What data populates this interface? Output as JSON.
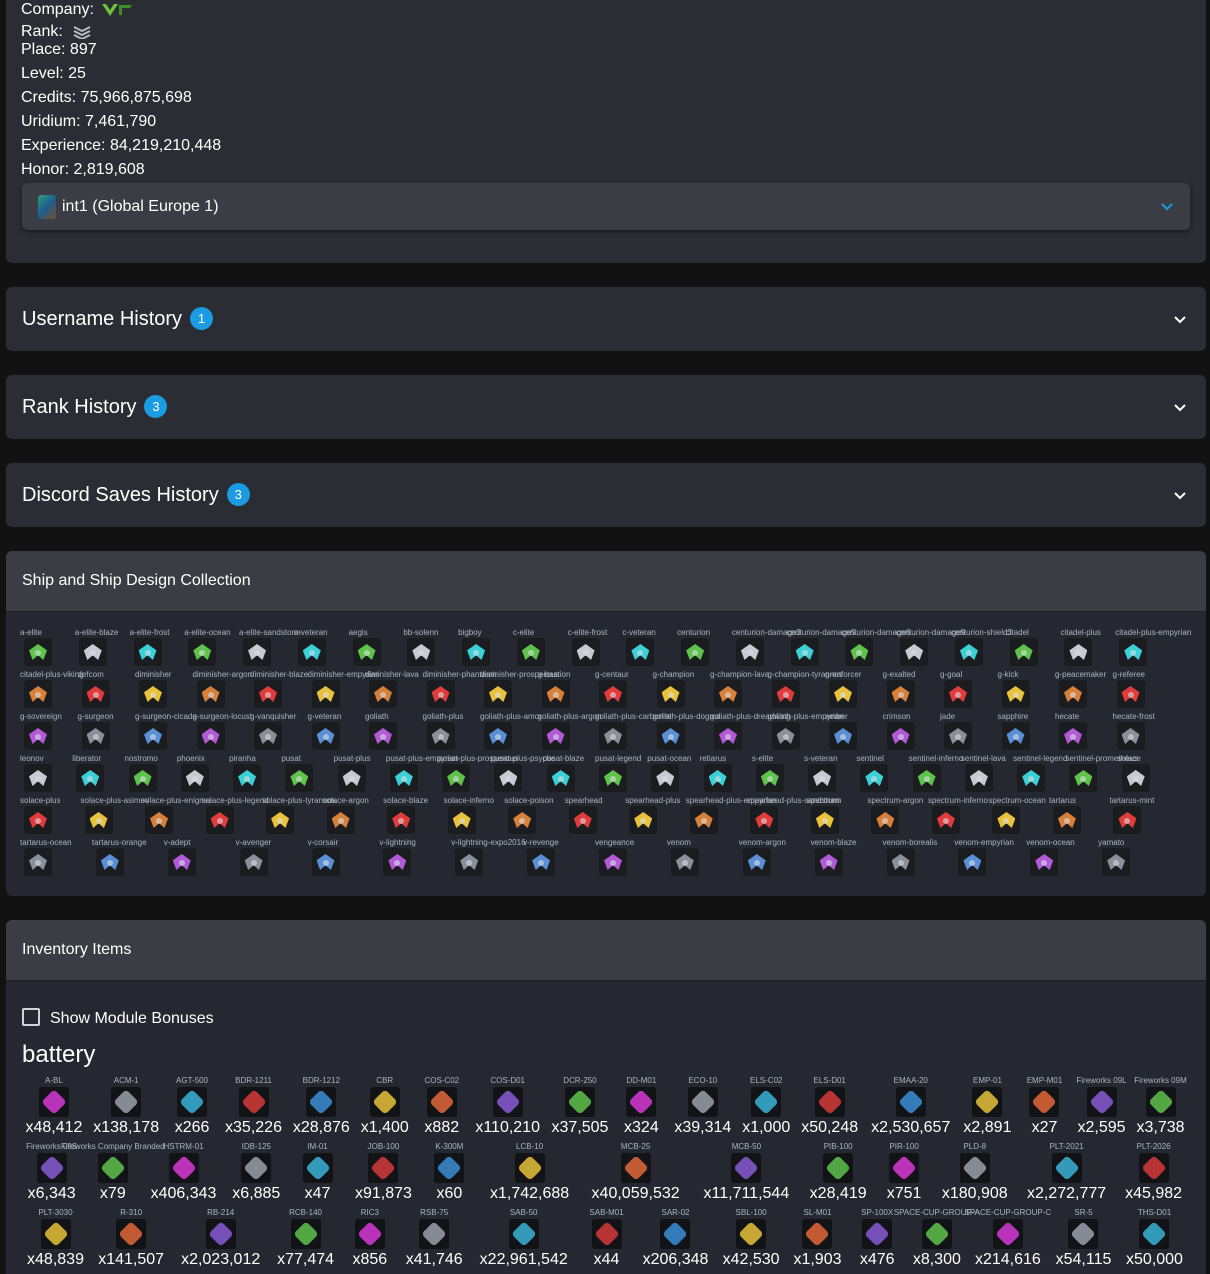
{
  "profile": {
    "company_label": "Company:",
    "company_icon": "vru-logo-icon",
    "rank_label": "Rank:",
    "rank_icon": "rank-chevrons-icon",
    "place": "Place: 897",
    "level": "Level: 25",
    "credits": "Credits: 75,966,875,698",
    "uridium": "Uridium: 7,461,790",
    "experience": "Experience: 84,219,210,448",
    "honor": "Honor: 2,819,608",
    "server": "int1 (Global Europe 1)"
  },
  "accordions": {
    "username": {
      "title": "Username History",
      "count": "1"
    },
    "rank": {
      "title": "Rank History",
      "count": "3"
    },
    "discord": {
      "title": "Discord Saves History",
      "count": "3"
    }
  },
  "ships": {
    "title": "Ship and Ship Design Collection",
    "rows": [
      [
        "a-elite",
        "a-elite-blaze",
        "a-elite-frost",
        "a-elite-ocean",
        "a-elite-sandstorm",
        "a-veteran",
        "aegis",
        "bb-solenn",
        "bigboy",
        "c-elite",
        "c-elite-frost",
        "c-veteran",
        "centurion",
        "centurion-damage3",
        "centurion-damage5",
        "centurion-damage6",
        "centurion-damage9",
        "centurion-shield3",
        "citadel",
        "citadel-plus",
        "citadel-plus-empyrian"
      ],
      [
        "citadel-plus-viking",
        "defcom",
        "diminisher",
        "diminisher-argon",
        "diminisher-blaze",
        "diminisher-empyrian",
        "diminisher-lava",
        "diminisher-phantasm",
        "diminisher-prosperous",
        "g-bastion",
        "g-centaur",
        "g-champion",
        "g-champion-lava",
        "g-champion-tyrannos",
        "g-enforcer",
        "g-exalted",
        "g-goal",
        "g-kick",
        "g-peacemaker",
        "g-referee"
      ],
      [
        "g-sovereign",
        "g-surgeon",
        "g-surgeon-cicada",
        "g-surgeon-locust",
        "g-vanquisher",
        "g-veteran",
        "goliath",
        "goliath-plus",
        "goliath-plus-amor",
        "goliath-plus-argon",
        "goliath-plus-carbonite",
        "goliath-plus-dogma",
        "goliath-plus-dreadwing",
        "goliath-plus-empyrian",
        "amber",
        "crimson",
        "jade",
        "sapphire",
        "hecate",
        "hecate-frost"
      ],
      [
        "leonov",
        "liberator",
        "nostromo",
        "phoenix",
        "piranha",
        "pusat",
        "pusat-plus",
        "pusat-plus-empyrian",
        "pusat-plus-prosperous",
        "pusat-plus-psyche",
        "pusat-blaze",
        "pusat-legend",
        "pusat-ocean",
        "retiarus",
        "s-elite",
        "s-veteran",
        "sentinel",
        "sentinel-inferno",
        "sentinel-lava",
        "sentinel-legend",
        "sentinel-prometheus",
        "solace"
      ],
      [
        "solace-plus",
        "solace-plus-asimov",
        "solace-plus-enigma",
        "solace-plus-legend",
        "solace-plus-tyrannos",
        "solace-argon",
        "solace-blaze",
        "solace-inferno",
        "solace-poison",
        "spearhead",
        "spearhead-plus",
        "spearhead-plus-empyrian",
        "spearhead-plus-sandstorm",
        "spectrum",
        "spectrum-argon",
        "spectrum-inferno",
        "spectrum-ocean",
        "tartarus",
        "tartarus-mint"
      ],
      [
        "tartarus-ocean",
        "tartarus-orange",
        "v-adept",
        "v-avenger",
        "v-corsair",
        "v-lightning",
        "v-lightning-expo2016",
        "v-revenge",
        "vengeance",
        "venom",
        "venom-argon",
        "venom-blaze",
        "venom-borealis",
        "venom-empyrian",
        "venom-ocean",
        "yamato"
      ],
      []
    ]
  },
  "inventory": {
    "title": "Inventory Items",
    "toggle_label": "Show Module Bonuses",
    "category": "battery",
    "rows": [
      [
        {
          "name": "A-BL",
          "count": "x48,412"
        },
        {
          "name": "ACM-1",
          "count": "x138,178"
        },
        {
          "name": "AGT-500",
          "count": "x266"
        },
        {
          "name": "BDR-1211",
          "count": "x35,226"
        },
        {
          "name": "BDR-1212",
          "count": "x28,876"
        },
        {
          "name": "CBR",
          "count": "x1,400"
        },
        {
          "name": "COS-C02",
          "count": "x882"
        },
        {
          "name": "COS-D01",
          "count": "x110,210"
        },
        {
          "name": "DCR-250",
          "count": "x37,505"
        },
        {
          "name": "DD-M01",
          "count": "x324"
        },
        {
          "name": "ECO-10",
          "count": "x39,314"
        },
        {
          "name": "ELS-C02",
          "count": "x1,000"
        },
        {
          "name": "ELS-D01",
          "count": "x50,248"
        },
        {
          "name": "EMAA-20",
          "count": "x2,530,657"
        },
        {
          "name": "EMP-01",
          "count": "x2,891"
        },
        {
          "name": "EMP-M01",
          "count": "x27"
        },
        {
          "name": "Fireworks 09L",
          "count": "x2,595"
        },
        {
          "name": "Fireworks 09M",
          "count": "x3,738"
        }
      ],
      [
        {
          "name": "Fireworks 09S",
          "count": "x6,343"
        },
        {
          "name": "Fireworks Company Branded",
          "count": "x79"
        },
        {
          "name": "HSTRM-01",
          "count": "x406,343"
        },
        {
          "name": "IDB-125",
          "count": "x6,885"
        },
        {
          "name": "IM-01",
          "count": "x47"
        },
        {
          "name": "JOB-100",
          "count": "x91,873"
        },
        {
          "name": "K-300M",
          "count": "x60"
        },
        {
          "name": "LCB-10",
          "count": "x1,742,688"
        },
        {
          "name": "MCB-25",
          "count": "x40,059,532"
        },
        {
          "name": "MCB-50",
          "count": "x11,711,544"
        },
        {
          "name": "PIB-100",
          "count": "x28,419"
        },
        {
          "name": "PIR-100",
          "count": "x751"
        },
        {
          "name": "PLD-8",
          "count": "x180,908"
        },
        {
          "name": "PLT-2021",
          "count": "x2,272,777"
        },
        {
          "name": "PLT-2026",
          "count": "x45,982"
        }
      ],
      [
        {
          "name": "PLT-3030",
          "count": "x48,839"
        },
        {
          "name": "R-310",
          "count": "x141,507"
        },
        {
          "name": "RB-214",
          "count": "x2,023,012"
        },
        {
          "name": "RCB-140",
          "count": "x77,474"
        },
        {
          "name": "RIC3",
          "count": "x856"
        },
        {
          "name": "RSB-75",
          "count": "x41,746"
        },
        {
          "name": "SAB-50",
          "count": "x22,961,542"
        },
        {
          "name": "SAB-M01",
          "count": "x44"
        },
        {
          "name": "SAR-02",
          "count": "x206,348"
        },
        {
          "name": "SBL-100",
          "count": "x42,530"
        },
        {
          "name": "SL-M01",
          "count": "x1,903"
        },
        {
          "name": "SP-100X",
          "count": "x476"
        },
        {
          "name": "SPACE-CUP-GROUP-A",
          "count": "x8,300"
        },
        {
          "name": "SPACE-CUP-GROUP-C",
          "count": "x214,616"
        },
        {
          "name": "SR-5",
          "count": "x54,115"
        },
        {
          "name": "THS-D01",
          "count": "x50,000"
        }
      ]
    ]
  },
  "colors": {
    "accent_blue": "#1a9be2",
    "card_bg": "#2a2d33",
    "page_bg": "#121212"
  }
}
